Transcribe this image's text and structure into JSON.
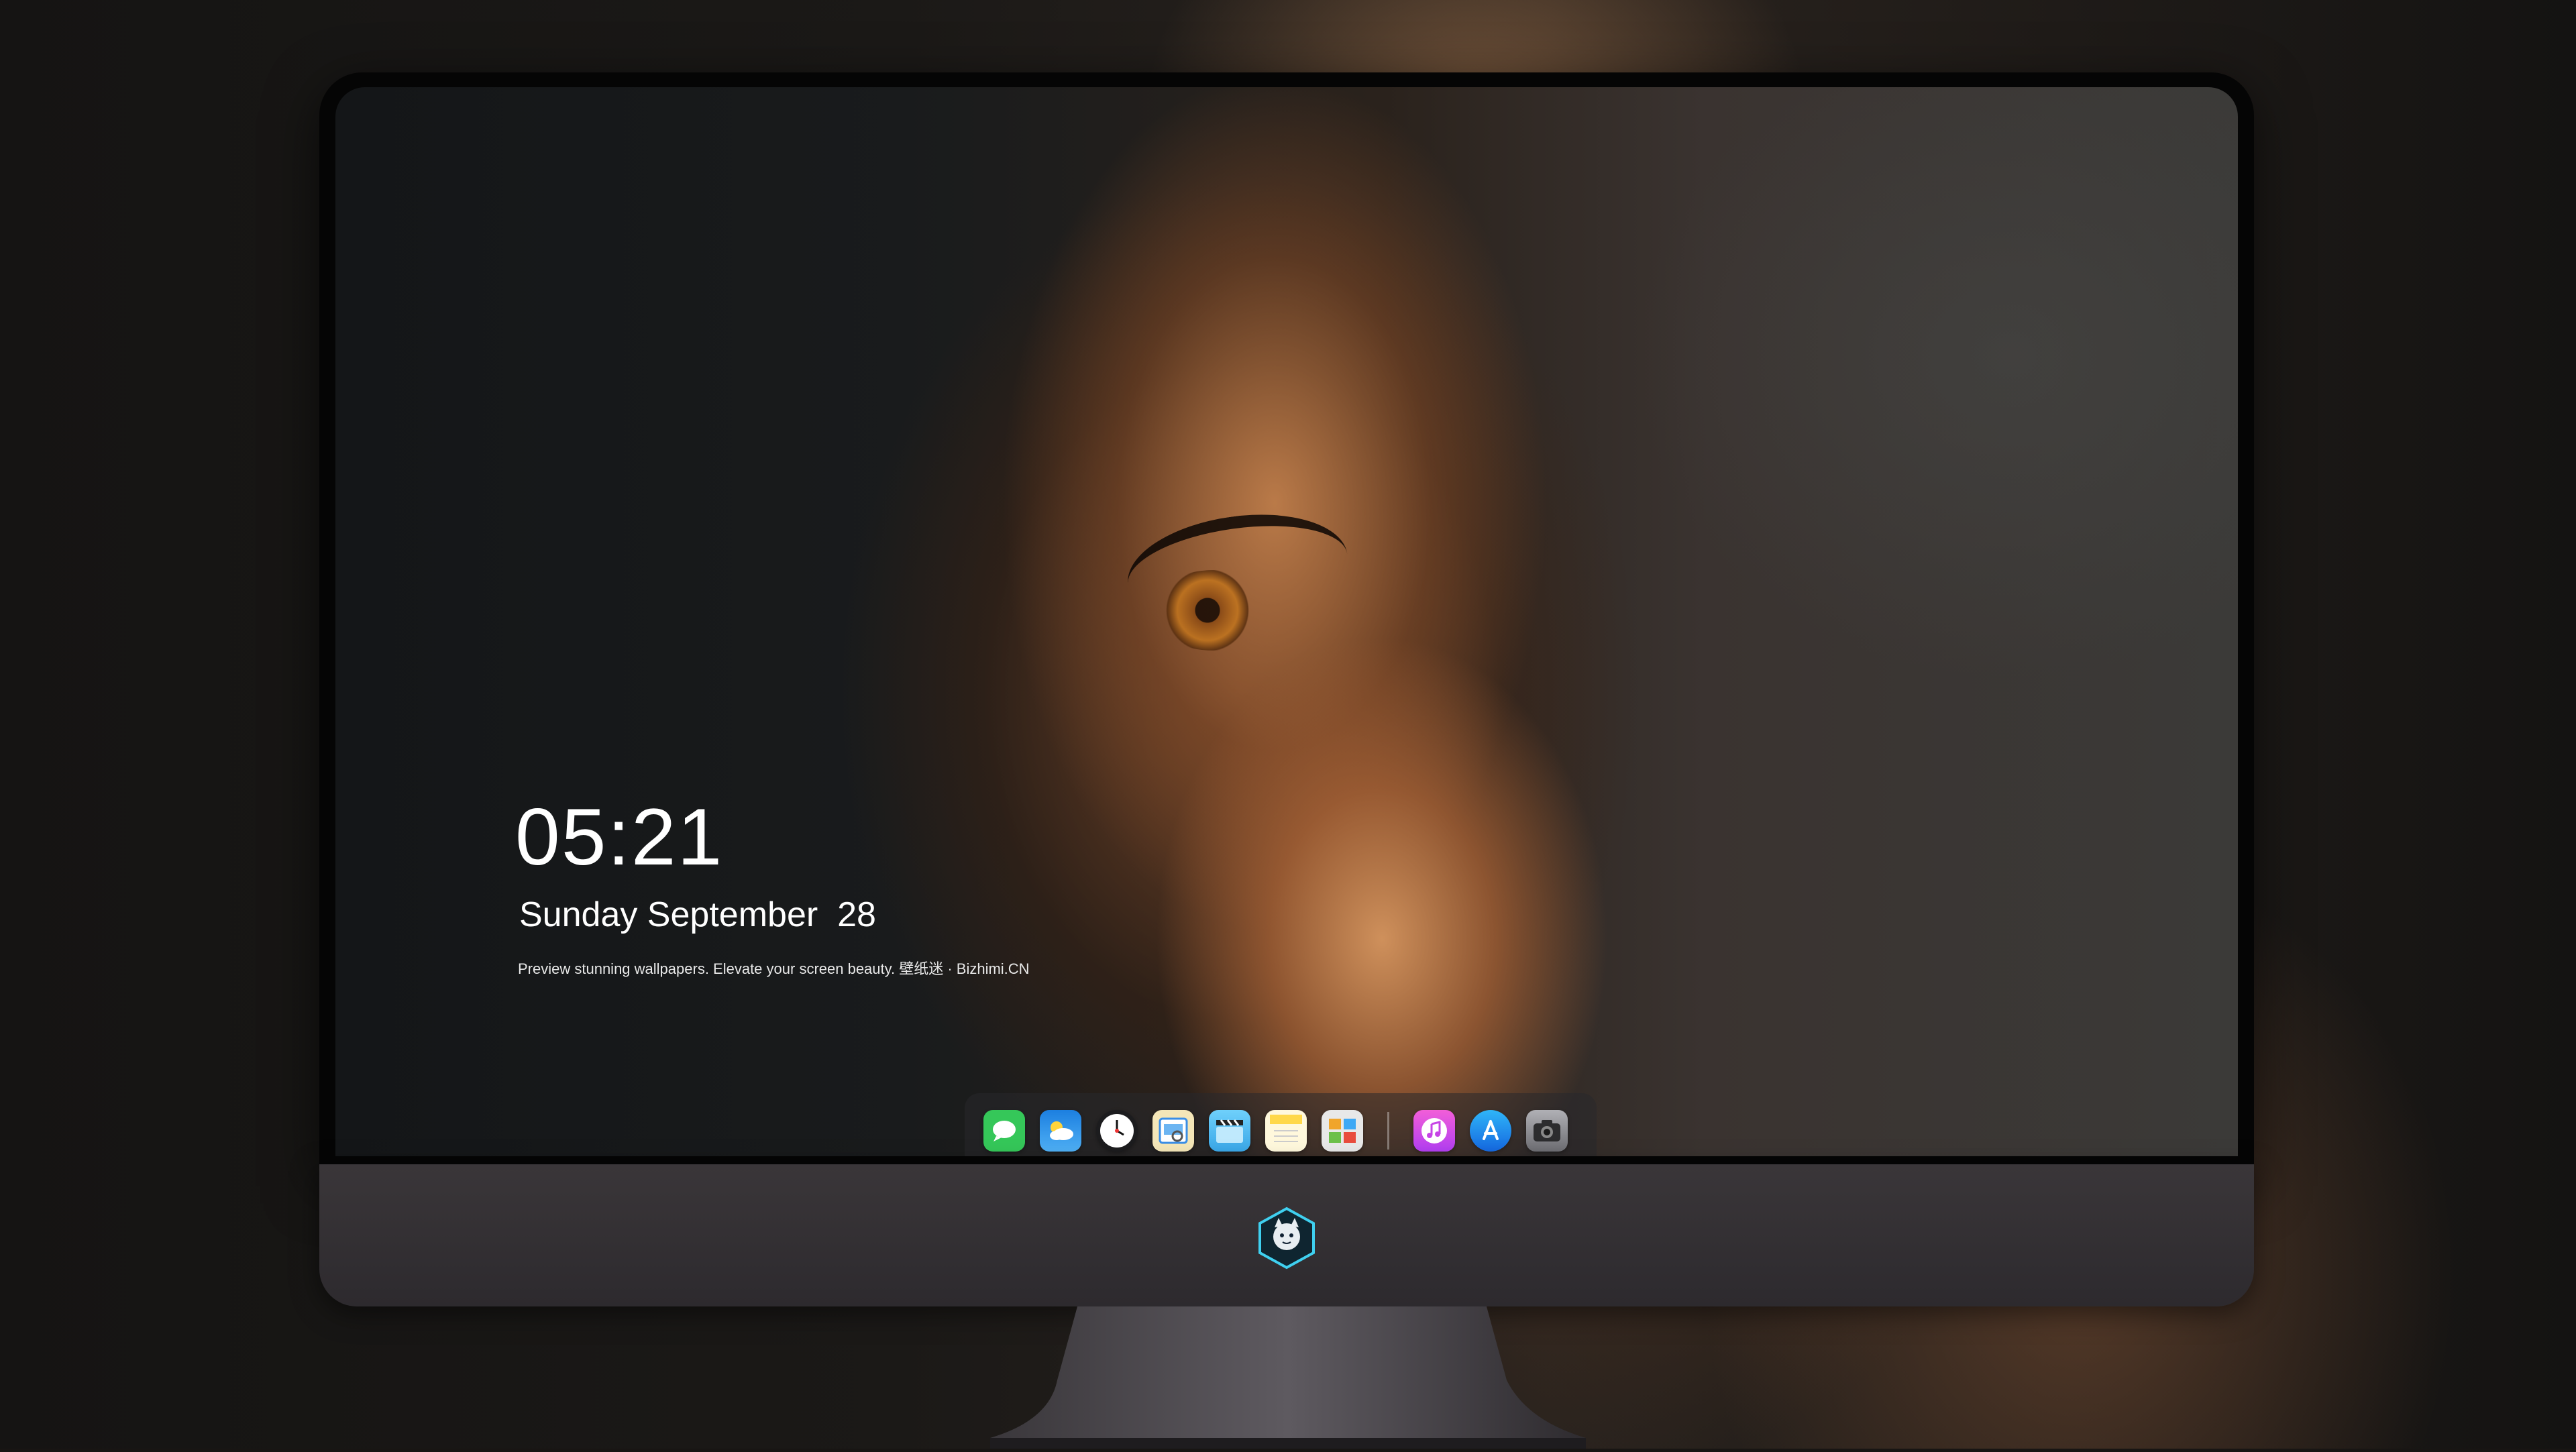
{
  "lock_screen": {
    "time": "05:21",
    "date": "Sunday September  28",
    "tagline": "Preview stunning wallpapers. Elevate your screen beauty. 壁纸迷 · Bizhimi.CN"
  },
  "dock": {
    "apps": [
      {
        "name": "Messages",
        "icon": "messages-icon",
        "color": "#35c759"
      },
      {
        "name": "Weather",
        "icon": "weather-icon",
        "color": "#1e8fe8"
      },
      {
        "name": "Clock",
        "icon": "clock-icon",
        "color": "#1c1c1e"
      },
      {
        "name": "Preview",
        "icon": "preview-icon",
        "color": "#f2d36a"
      },
      {
        "name": "Clips",
        "icon": "clapperboard-icon",
        "color": "#5ac8fa"
      },
      {
        "name": "Notes",
        "icon": "notes-icon",
        "color": "#ffd84a"
      },
      {
        "name": "Photo Booth",
        "icon": "photo-booth-icon",
        "color": "#e6e6e6"
      },
      {
        "name": "iTunes",
        "icon": "itunes-icon",
        "color": "#d64ef0"
      },
      {
        "name": "App Store",
        "icon": "app-store-icon",
        "color": "#1f8cf2"
      },
      {
        "name": "Camera",
        "icon": "camera-icon",
        "color": "#8e8e93"
      }
    ]
  },
  "colors": {
    "bezel": "#050505",
    "chin": "#3a3639",
    "text": "#ffffff"
  }
}
